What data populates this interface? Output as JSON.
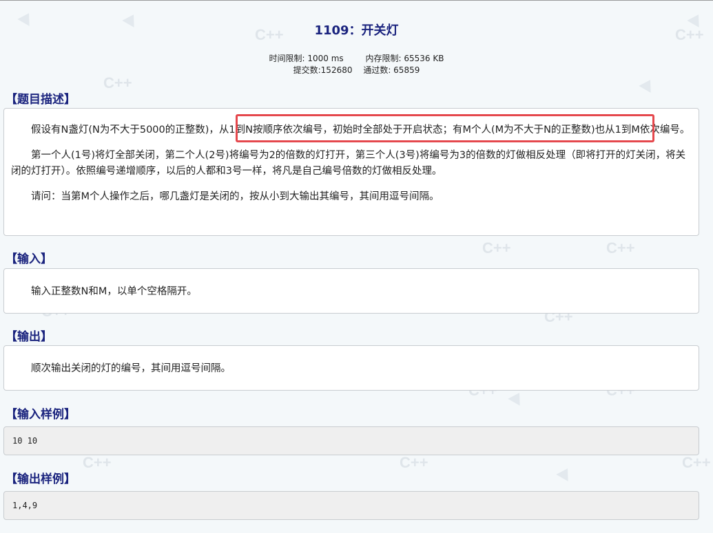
{
  "problem": {
    "title": "1109：开关灯",
    "time_limit": "时间限制: 1000 ms",
    "memory_limit": "内存限制: 65536 KB",
    "submissions": "提交数:152680",
    "accepted": "通过数: 65859"
  },
  "sections": {
    "description": {
      "heading": "【题目描述】",
      "paragraphs": [
        "假设有N盏灯(N为不大于5000的正整数)，从1到N按顺序依次编号，初始时全部处于开启状态；有M个人(M为不大于N的正整数)也从1到M依次编号。",
        "第一个人(1号)将灯全部关闭，第二个人(2号)将编号为2的倍数的灯打开，第三个人(3号)将编号为3的倍数的灯做相反处理（即将打开的灯关闭，将关闭的灯打开）。依照编号递增顺序，以后的人都和3号一样，将凡是自己编号倍数的灯做相反处理。",
        "请问：当第M个人操作之后，哪几盏灯是关闭的，按从小到大输出其编号，其间用逗号间隔。"
      ]
    },
    "input": {
      "heading": "【输入】",
      "text": "输入正整数N和M，以单个空格隔开。"
    },
    "output": {
      "heading": "【输出】",
      "text": "顺次输出关闭的灯的编号，其间用逗号间隔。"
    },
    "sample_input": {
      "heading": "【输入样例】",
      "text": "10 10"
    },
    "sample_output": {
      "heading": "【输出样例】",
      "text": "1,4,9"
    }
  },
  "watermark_text": "C++",
  "colors": {
    "heading": "#1a237e",
    "highlight_border": "#e5484d",
    "background": "#f4f8fa"
  }
}
